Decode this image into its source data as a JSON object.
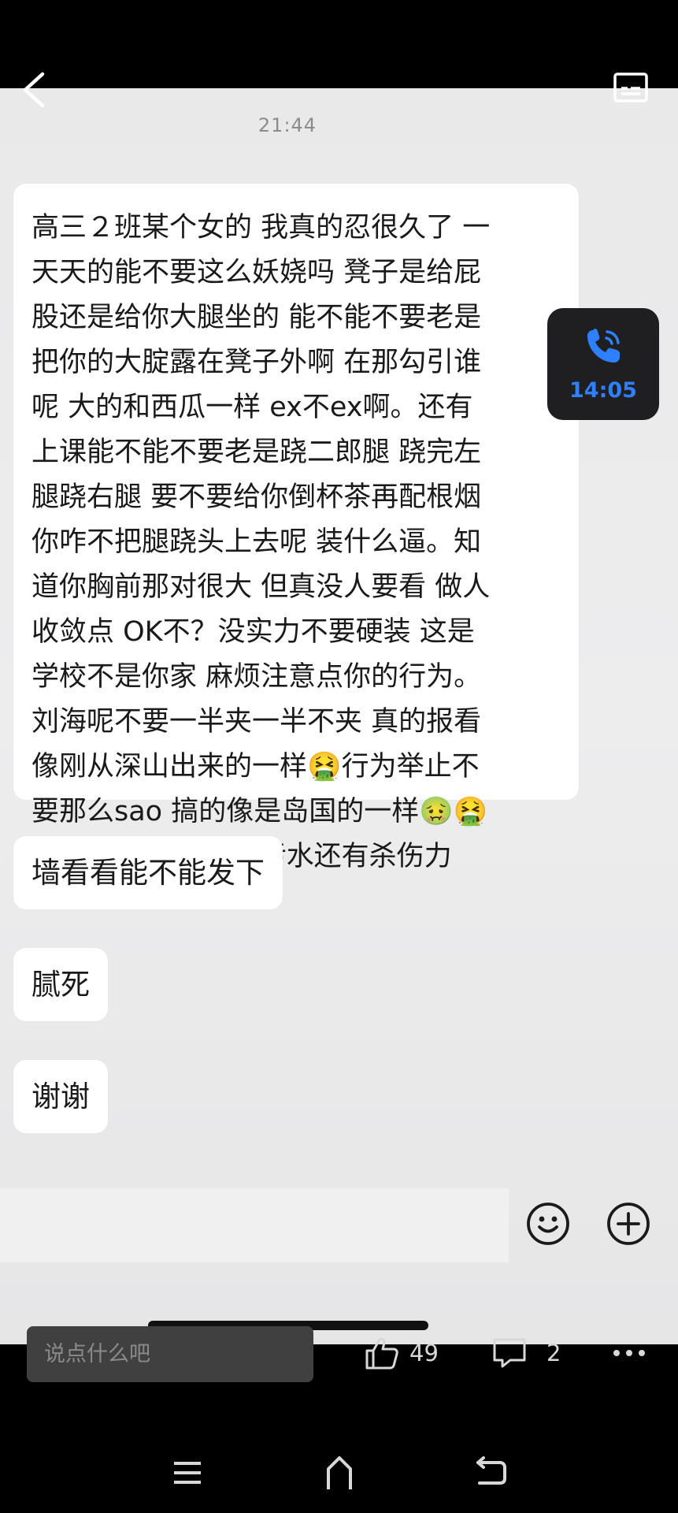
{
  "status": {
    "time": "21:44"
  },
  "messages": [
    {
      "lines": [
        "高三２班某个女的 我真的忍很久了 一",
        "天天的能不要这么妖娆吗 凳子是给屁",
        "股还是给你大腿坐的 能不能不要老是",
        "把你的大腚露在凳子外啊 在那勾引谁",
        "呢 大的和西瓜一样 ex不ex啊。还有",
        "上课能不能不要老是跷二郎腿 跷完左",
        "腿跷右腿 要不要给你倒杯茶再配根烟",
        "你咋不把腿跷头上去呢 装什么逼。知",
        "道你胸前那对很大 但真没人要看 做人",
        "收敛点 OK不？没实力不要硬装 这是",
        "学校不是你家 麻烦注意点你的行为。",
        "刘海呢不要一半夹一半不夹 真的报看",
        "像刚从深山出来的一样🤮行为举止不",
        "要那么sao 搞的像是岛国的一样🤢🤮",
        "真的比🇯🇵排放的核污水还有杀伤力"
      ]
    },
    {
      "text": "墙看看能不能发下"
    },
    {
      "text": "腻死"
    },
    {
      "text": "谢谢"
    }
  ],
  "call_float": {
    "time": "14:05",
    "icon": "phone-icon",
    "color": "#2f80ff"
  },
  "composer": {
    "emoji_icon": "smiley-icon",
    "plus_icon": "plus-icon"
  },
  "bottom": {
    "comment_placeholder": "说点什么吧",
    "like_count": "49",
    "comment_count": "2",
    "more_icon": "more-icon"
  },
  "nav": {
    "menu_icon": "menu-icon",
    "home_icon": "home-icon",
    "back_icon": "back-arrow-icon"
  }
}
